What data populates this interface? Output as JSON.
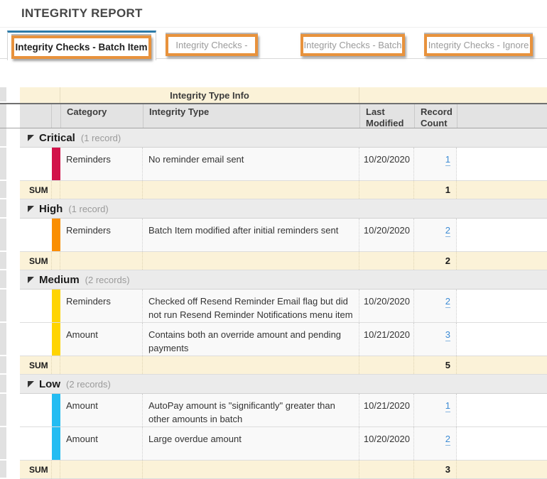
{
  "title": "INTEGRITY REPORT",
  "tabs": [
    {
      "label": "Integrity Checks - Batch Item",
      "active": true
    },
    {
      "label": "Integrity Checks -",
      "active": false
    },
    {
      "label": "Integrity Checks - Batch",
      "active": false
    },
    {
      "label": "Integrity Checks - Ignore",
      "active": false
    }
  ],
  "annotation_color": "#e8923c",
  "active_tab_accent": "#2d7ba8",
  "table": {
    "span_header": "Integrity Type Info",
    "columns": {
      "category": "Category",
      "integrity_type": "Integrity Type",
      "last_modified": "Last Modified",
      "record_count": "Record Count"
    },
    "sum_label": "SUM",
    "groups": [
      {
        "severity": "Critical",
        "count_label": "(1 record)",
        "color": "#d2124a",
        "rows": [
          {
            "category": "Reminders",
            "integrity_type": "No reminder email sent",
            "last_modified": "10/20/2020",
            "record_count": "1"
          }
        ],
        "sum": "1"
      },
      {
        "severity": "High",
        "count_label": "(1 record)",
        "color": "#fa8e00",
        "rows": [
          {
            "category": "Reminders",
            "integrity_type": "Batch Item modified after initial reminders sent",
            "last_modified": "10/20/2020",
            "record_count": "2"
          }
        ],
        "sum": "2"
      },
      {
        "severity": "Medium",
        "count_label": "(2 records)",
        "color": "#ffd400",
        "rows": [
          {
            "category": "Reminders",
            "integrity_type": "Checked off Resend Reminder Email flag but did not run Resend Reminder Notifications menu item",
            "last_modified": "10/20/2020",
            "record_count": "2"
          },
          {
            "category": "Amount",
            "integrity_type": "Contains both an override amount and pending payments",
            "last_modified": "10/21/2020",
            "record_count": "3"
          }
        ],
        "sum": "5"
      },
      {
        "severity": "Low",
        "count_label": "(2 records)",
        "color": "#23bcf2",
        "rows": [
          {
            "category": "Amount",
            "integrity_type": "AutoPay amount is \"significantly\" greater than other amounts in batch",
            "last_modified": "10/21/2020",
            "record_count": "1"
          },
          {
            "category": "Amount",
            "integrity_type": "Large overdue amount",
            "last_modified": "10/20/2020",
            "record_count": "2"
          }
        ],
        "sum": "3"
      }
    ]
  }
}
